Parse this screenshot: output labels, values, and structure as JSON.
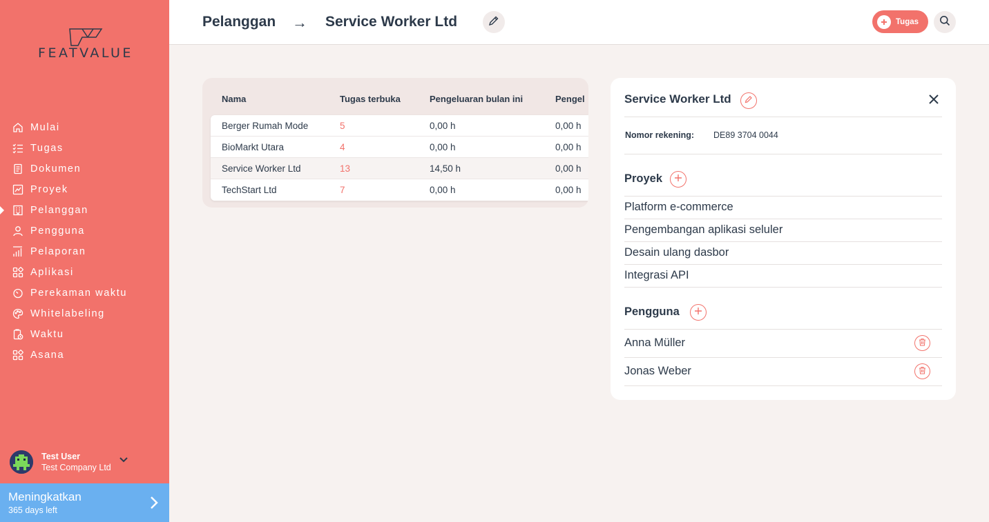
{
  "brand": {
    "name": "FEATVALUE",
    "accent": "#f2726b",
    "upgrade_color": "#6ab0f0"
  },
  "sidebar": {
    "items": [
      {
        "label": "Mulai",
        "icon": "home-icon"
      },
      {
        "label": "Tugas",
        "icon": "checklist-icon"
      },
      {
        "label": "Dokumen",
        "icon": "document-icon"
      },
      {
        "label": "Proyek",
        "icon": "project-chart-icon"
      },
      {
        "label": "Pelanggan",
        "icon": "building-icon",
        "active": true
      },
      {
        "label": "Pengguna",
        "icon": "user-icon"
      },
      {
        "label": "Pelaporan",
        "icon": "report-bars-icon"
      },
      {
        "label": "Aplikasi",
        "icon": "apps-grid-icon"
      },
      {
        "label": "Perekaman waktu",
        "icon": "stopwatch-icon"
      },
      {
        "label": "Whitelabeling",
        "icon": "palette-icon"
      },
      {
        "label": "Waktu",
        "icon": "time-clipboard-icon"
      },
      {
        "label": "Asana",
        "icon": "apps-grid-icon"
      }
    ],
    "user": {
      "name": "Test User",
      "company": "Test Company Ltd"
    },
    "upgrade": {
      "title": "Meningkatkan",
      "subtitle": "365 days left"
    }
  },
  "header": {
    "breadcrumb_parent": "Pelanggan",
    "breadcrumb_sep": "→",
    "breadcrumb_current": "Service Worker Ltd",
    "task_button": "Tugas"
  },
  "table": {
    "columns": [
      "Nama",
      "Tugas terbuka",
      "Pengeluaran bulan ini",
      "Pengel"
    ],
    "rows": [
      {
        "name": "Berger Rumah Mode",
        "open": "5",
        "spend": "0,00 h",
        "spend2": "0,00 h"
      },
      {
        "name": "BioMarkt Utara",
        "open": "4",
        "spend": "0,00 h",
        "spend2": "0,00 h"
      },
      {
        "name": "Service Worker Ltd",
        "open": "13",
        "spend": "14,50 h",
        "spend2": "0,00 h",
        "selected": true
      },
      {
        "name": "TechStart Ltd",
        "open": "7",
        "spend": "0,00 h",
        "spend2": "0,00 h"
      }
    ]
  },
  "detail": {
    "title": "Service Worker Ltd",
    "account_label": "Nomor rekening:",
    "account_value": "DE89 3704 0044",
    "projects_title": "Proyek",
    "projects": [
      "Platform e-commerce",
      "Pengembangan aplikasi seluler",
      "Desain ulang dasbor",
      "Integrasi API"
    ],
    "users_title": "Pengguna",
    "users": [
      "Anna Müller",
      "Jonas Weber"
    ]
  }
}
